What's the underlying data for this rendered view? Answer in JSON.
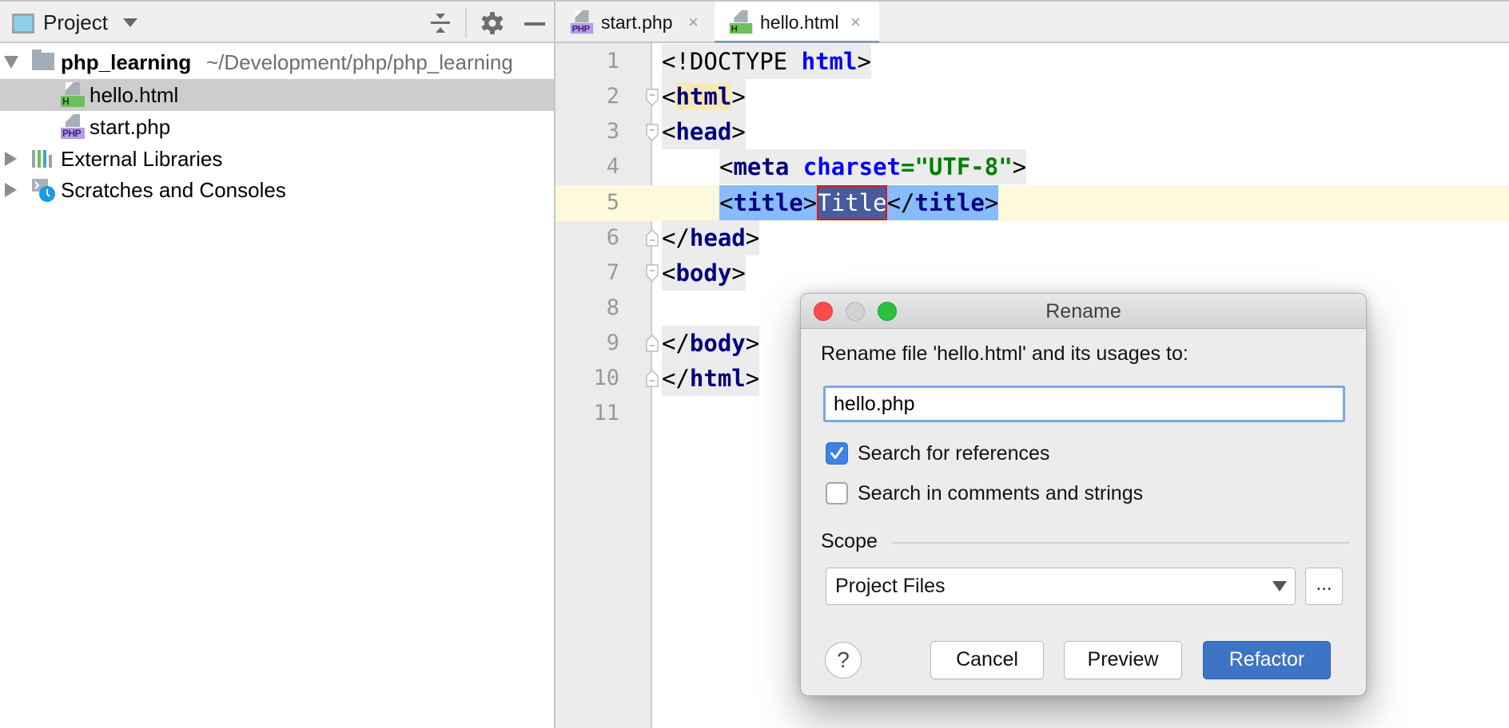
{
  "project_panel": {
    "title": "Project",
    "icons": [
      "collapse-all-icon",
      "gear-icon",
      "minimize-icon"
    ],
    "tree": [
      {
        "label": "php_learning",
        "path": "~/Development/php/php_learning",
        "type": "folder",
        "expanded": true
      },
      {
        "label": "hello.html",
        "type": "html-file",
        "selected": true
      },
      {
        "label": "start.php",
        "type": "php-file"
      },
      {
        "label": "External Libraries",
        "type": "libraries",
        "expanded": false
      },
      {
        "label": "Scratches and Consoles",
        "type": "scratches",
        "expanded": false
      }
    ],
    "badges": {
      "html": "H",
      "php": "PHP"
    }
  },
  "editor": {
    "tabs": [
      {
        "label": "start.php",
        "type": "php-file",
        "active": false,
        "close": "×"
      },
      {
        "label": "hello.html",
        "type": "html-file",
        "active": true,
        "close": "×"
      }
    ],
    "current_line": 5,
    "lines": [
      {
        "no": "1",
        "parts": [
          "<!DOCTYPE ",
          "html",
          ">"
        ]
      },
      {
        "no": "2",
        "parts": [
          "<",
          "html",
          ">"
        ]
      },
      {
        "no": "3",
        "parts": [
          "<",
          "head",
          ">"
        ]
      },
      {
        "no": "4",
        "parts": [
          "<",
          "meta",
          " ",
          "charset",
          "=",
          "\"UTF-8\"",
          ">"
        ]
      },
      {
        "no": "5",
        "parts": [
          "<",
          "title",
          ">",
          "Title",
          "</",
          "title",
          ">"
        ]
      },
      {
        "no": "6",
        "parts": [
          "</",
          "head",
          ">"
        ]
      },
      {
        "no": "7",
        "parts": [
          "<",
          "body",
          ">"
        ]
      },
      {
        "no": "8",
        "parts": []
      },
      {
        "no": "9",
        "parts": [
          "</",
          "body",
          ">"
        ]
      },
      {
        "no": "10",
        "parts": [
          "</",
          "html",
          ">"
        ]
      },
      {
        "no": "11",
        "parts": []
      }
    ]
  },
  "dialog": {
    "title": "Rename",
    "prompt": "Rename file 'hello.html' and its usages to:",
    "input_value": "hello.php",
    "options": [
      {
        "label": "Search for references",
        "checked": true
      },
      {
        "label": "Search in comments and strings",
        "checked": false
      }
    ],
    "scope_label": "Scope",
    "scope_value": "Project Files",
    "more_label": "...",
    "help_label": "?",
    "buttons": {
      "cancel": "Cancel",
      "preview": "Preview",
      "refactor": "Refactor"
    },
    "check_mark": "✓"
  },
  "colors": {
    "accent": "#3e74c5",
    "selection": "#87bbf9",
    "caret_row": "#fef9db",
    "tag": "#000080",
    "attribute": "#0000ff",
    "string": "#008000"
  }
}
